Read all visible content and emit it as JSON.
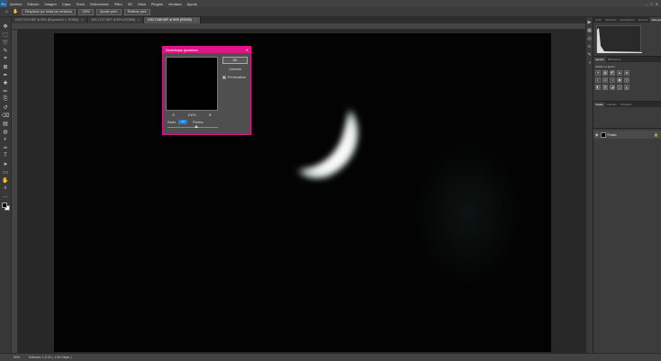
{
  "app": {
    "logo": "Ps",
    "menu": [
      "Archivo",
      "Edición",
      "Imagen",
      "Capa",
      "Texto",
      "Seleccionar",
      "Filtro",
      "3D",
      "Vista",
      "Plugins",
      "Ventana",
      "Ayuda"
    ],
    "window_controls": [
      "–",
      "□",
      "✕"
    ]
  },
  "options_bar": {
    "home_icon": "home-icon",
    "hand_icon": "hand-icon",
    "scroll_all_label": "Desplazar por todas las ventanas",
    "zoom_value": "100%",
    "fit_screen_label": "Ajustar pant.",
    "fill_screen_label": "Rellenar pant."
  },
  "tabs": [
    {
      "label": "DSC7123.NEF al 50% (Exposición 1, RGB/8)",
      "active": false
    },
    {
      "label": "DSC7157.NEF al 50% (RGB/8)",
      "active": false
    },
    {
      "label": "DSC7158.NEF al 50% (RGB/8)",
      "active": true
    }
  ],
  "tools": [
    "move-icon",
    "marquee-icon",
    "lasso-icon",
    "quick-select-icon",
    "crop-icon",
    "frame-icon",
    "eyedropper-icon",
    "healing-icon",
    "brush-icon",
    "stamp-icon",
    "history-brush-icon",
    "eraser-icon",
    "gradient-icon",
    "blur-icon",
    "dodge-icon",
    "pen-icon",
    "type-icon",
    "path-select-icon",
    "rectangle-icon",
    "hand-icon",
    "zoom-icon",
    "more-tools-icon"
  ],
  "tool_glyphs": [
    "✥",
    "⬚",
    "➰",
    "✎",
    "⌗",
    "⊠",
    "✒",
    "✚",
    "✏",
    "⎘",
    "↺",
    "⌫",
    "▤",
    "◍",
    "◐",
    "✑",
    "T",
    "➤",
    "▭",
    "✋",
    "⌕",
    "…"
  ],
  "colors": {
    "foreground": "#000000",
    "background": "#ffffff",
    "dialog_accent": "#e0138a",
    "input_highlight": "#1f7fd6"
  },
  "status": {
    "zoom": "50%",
    "doc_info": "Editores: 1,9 Ch ( 1.96 Gbyte )"
  },
  "panels": {
    "top_tabs": [
      "Color",
      "Muestras",
      "Degradados",
      "Motivos",
      "Histograma"
    ],
    "top_active": "Histograma",
    "adjust_tabs": [
      "Ajustes",
      "Bibliotecas"
    ],
    "adjust_title": "Añadir un ajuste",
    "adjust_icons": [
      "☀",
      "▦",
      "◩",
      "▲",
      "◈",
      "◐",
      "⚖",
      "◑",
      "▣",
      "◎",
      "◧",
      "▥",
      "◪",
      "◫",
      "◭"
    ],
    "layer_tabs": [
      "Capas",
      "Canales",
      "Trazados"
    ],
    "layer_name": "Fondo",
    "layer_lock": "🔒"
  },
  "dock_icons": [
    "▶",
    "▦",
    "◎",
    "≡",
    "✎",
    "◑"
  ],
  "dialog": {
    "title": "Desenfoque gaussiano",
    "close": "✕",
    "ok_label": "OK",
    "cancel_label": "Cancelar",
    "preview_checked": true,
    "preview_label": "Previsualizar",
    "zoom_out": "⊖",
    "zoom_in": "⊕",
    "zoom_value": "100%",
    "radius_label": "Radio:",
    "radius_value": "4,5",
    "radius_unit": "Píxeles"
  }
}
